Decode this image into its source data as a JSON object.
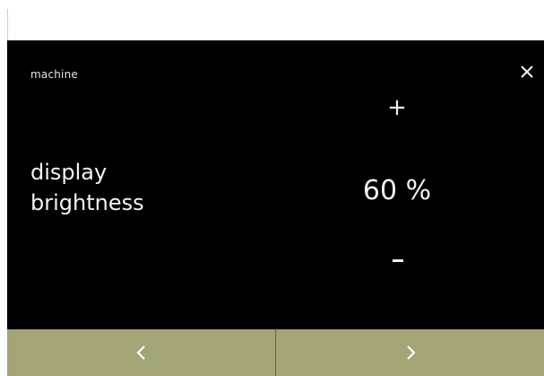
{
  "screen": {
    "breadcrumb": "machine",
    "setting_label_line1": "display",
    "setting_label_line2": "brightness",
    "value_display": "60 %",
    "increase_label": "+",
    "decrease_label": "–"
  },
  "brightness": {
    "level_percent": 60
  },
  "icons": {
    "close": "close-icon",
    "previous": "chevron-left-icon",
    "next": "chevron-right-icon"
  },
  "colors": {
    "screen_background": "#000000",
    "text": "#f2f2f2",
    "bottom_bar": "#a3a577"
  }
}
